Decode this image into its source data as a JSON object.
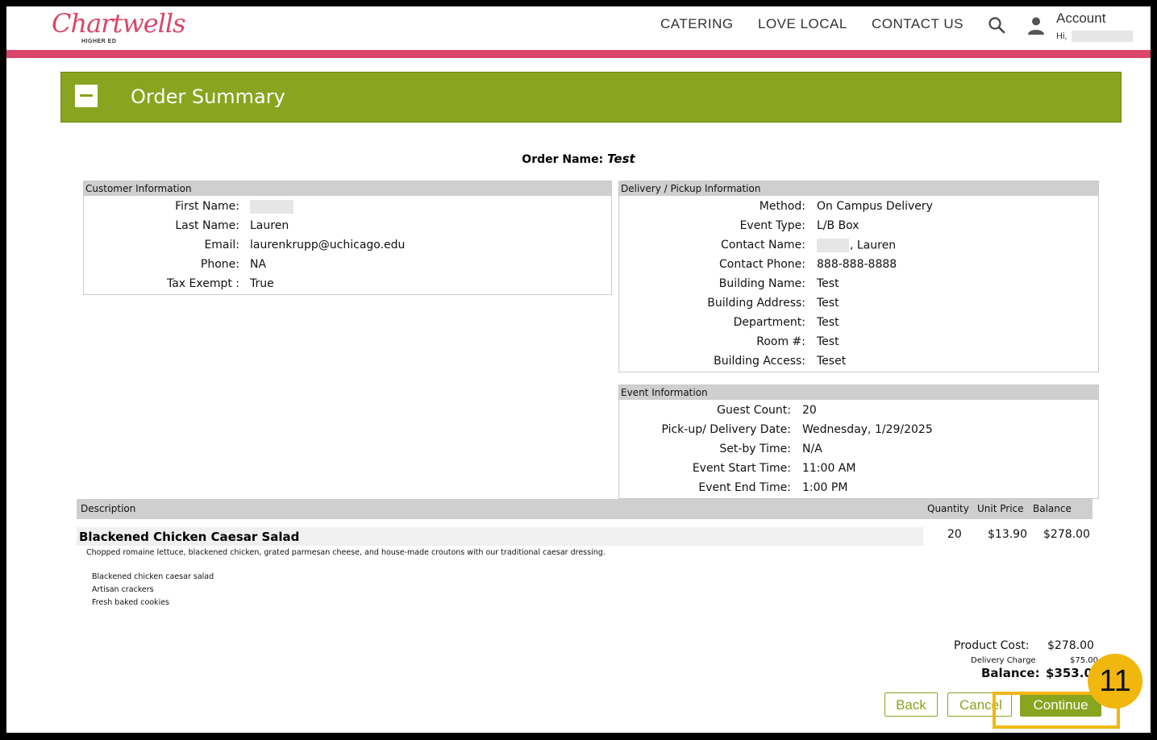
{
  "header": {
    "logo_text": "Chartwells",
    "logo_sub": "HIGHER ED",
    "nav": [
      "CATERING",
      "LOVE LOCAL",
      "CONTACT US"
    ],
    "account_label": "Account",
    "greeting": "Hi,"
  },
  "summary": {
    "title": "Order Summary",
    "order_name_label": "Order Name:",
    "order_name": "Test"
  },
  "customer": {
    "heading": "Customer Information",
    "rows": [
      {
        "label": "First Name:",
        "value": ""
      },
      {
        "label": "Last Name:",
        "value": "Lauren"
      },
      {
        "label": "Email:",
        "value": "laurenkrupp@uchicago.edu"
      },
      {
        "label": "Phone:",
        "value": "NA"
      },
      {
        "label": "Tax Exempt :",
        "value": "True"
      }
    ]
  },
  "delivery": {
    "heading": "Delivery / Pickup Information",
    "rows": [
      {
        "label": "Method:",
        "value": "On Campus Delivery"
      },
      {
        "label": "Event Type:",
        "value": "L/B Box"
      },
      {
        "label": "Contact Name:",
        "value": ", Lauren"
      },
      {
        "label": "Contact Phone:",
        "value": "888-888-8888"
      },
      {
        "label": "Building Name:",
        "value": "Test"
      },
      {
        "label": "Building Address:",
        "value": "Test"
      },
      {
        "label": "Department:",
        "value": "Test"
      },
      {
        "label": "Room #:",
        "value": "Test"
      },
      {
        "label": "Building Access:",
        "value": "Teset"
      }
    ]
  },
  "event": {
    "heading": "Event Information",
    "rows": [
      {
        "label": "Guest Count:",
        "value": "20"
      },
      {
        "label": "Pick-up/ Delivery Date:",
        "value": "Wednesday, 1/29/2025"
      },
      {
        "label": "Set-by Time:",
        "value": "N/A"
      },
      {
        "label": "Event Start Time:",
        "value": "11:00 AM"
      },
      {
        "label": "Event End Time:",
        "value": "1:00 PM"
      }
    ]
  },
  "items": {
    "columns": {
      "description": "Description",
      "quantity": "Quantity",
      "unit_price": "Unit Price",
      "balance": "Balance"
    },
    "item": {
      "name": "Blackened Chicken Caesar Salad",
      "quantity": "20",
      "unit_price": "$13.90",
      "balance": "$278.00",
      "description": "Chopped romaine lettuce, blackened chicken, grated parmesan cheese, and house-made croutons with our traditional caesar dressing.",
      "includes": [
        "Blackened chicken caesar salad",
        "Artisan crackers",
        "Fresh baked cookies"
      ]
    }
  },
  "totals": {
    "product_cost_label": "Product Cost:",
    "product_cost": "$278.00",
    "delivery_label": "Delivery Charge",
    "delivery": "$75.00",
    "balance_label": "Balance:",
    "balance": "$353.00"
  },
  "buttons": {
    "back": "Back",
    "cancel": "Cancel",
    "continue": "Continue"
  },
  "annotation": {
    "step": "11",
    "color": "#f1b70f"
  }
}
